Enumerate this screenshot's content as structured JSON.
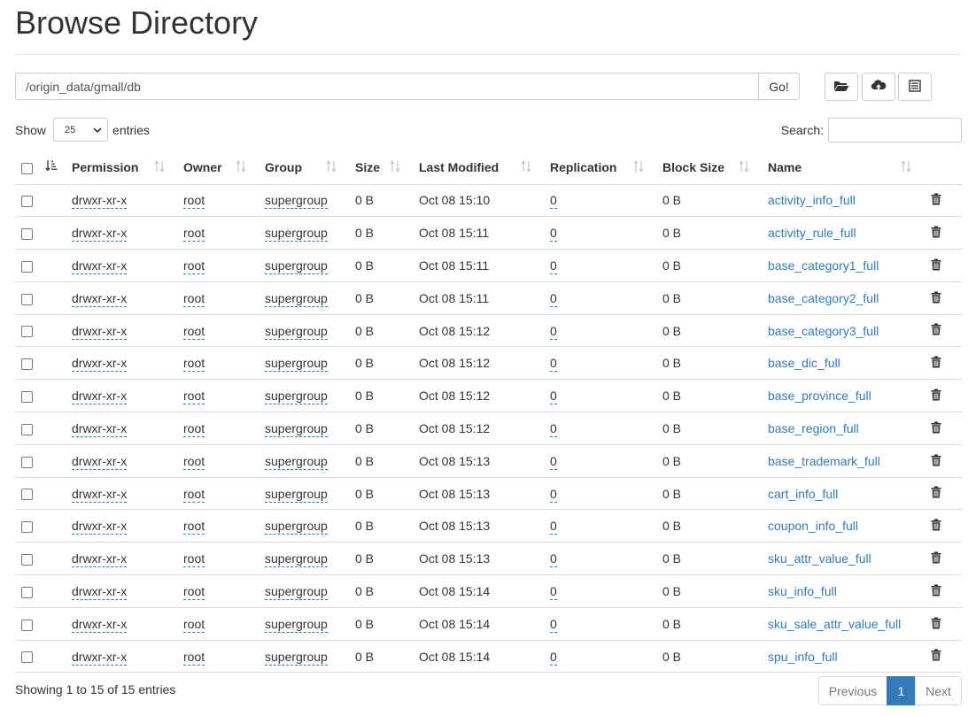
{
  "page_title": "Browse Directory",
  "path": {
    "value": "/origin_data/gmall/db",
    "go_label": "Go!"
  },
  "toolbar": {
    "icons": [
      "folder-open-icon",
      "cloud-upload-icon",
      "list-alt-icon"
    ]
  },
  "show_entries": {
    "show_label": "Show",
    "selected": "25",
    "entries_label": "entries"
  },
  "search": {
    "label": "Search:",
    "value": ""
  },
  "table": {
    "columns": [
      "Permission",
      "Owner",
      "Group",
      "Size",
      "Last Modified",
      "Replication",
      "Block Size",
      "Name"
    ],
    "rows": [
      {
        "permission": "drwxr-xr-x",
        "owner": "root",
        "group": "supergroup",
        "size": "0 B",
        "modified": "Oct 08 15:10",
        "replication": "0",
        "block_size": "0 B",
        "name": "activity_info_full"
      },
      {
        "permission": "drwxr-xr-x",
        "owner": "root",
        "group": "supergroup",
        "size": "0 B",
        "modified": "Oct 08 15:11",
        "replication": "0",
        "block_size": "0 B",
        "name": "activity_rule_full"
      },
      {
        "permission": "drwxr-xr-x",
        "owner": "root",
        "group": "supergroup",
        "size": "0 B",
        "modified": "Oct 08 15:11",
        "replication": "0",
        "block_size": "0 B",
        "name": "base_category1_full"
      },
      {
        "permission": "drwxr-xr-x",
        "owner": "root",
        "group": "supergroup",
        "size": "0 B",
        "modified": "Oct 08 15:11",
        "replication": "0",
        "block_size": "0 B",
        "name": "base_category2_full"
      },
      {
        "permission": "drwxr-xr-x",
        "owner": "root",
        "group": "supergroup",
        "size": "0 B",
        "modified": "Oct 08 15:12",
        "replication": "0",
        "block_size": "0 B",
        "name": "base_category3_full"
      },
      {
        "permission": "drwxr-xr-x",
        "owner": "root",
        "group": "supergroup",
        "size": "0 B",
        "modified": "Oct 08 15:12",
        "replication": "0",
        "block_size": "0 B",
        "name": "base_dic_full"
      },
      {
        "permission": "drwxr-xr-x",
        "owner": "root",
        "group": "supergroup",
        "size": "0 B",
        "modified": "Oct 08 15:12",
        "replication": "0",
        "block_size": "0 B",
        "name": "base_province_full"
      },
      {
        "permission": "drwxr-xr-x",
        "owner": "root",
        "group": "supergroup",
        "size": "0 B",
        "modified": "Oct 08 15:12",
        "replication": "0",
        "block_size": "0 B",
        "name": "base_region_full"
      },
      {
        "permission": "drwxr-xr-x",
        "owner": "root",
        "group": "supergroup",
        "size": "0 B",
        "modified": "Oct 08 15:13",
        "replication": "0",
        "block_size": "0 B",
        "name": "base_trademark_full"
      },
      {
        "permission": "drwxr-xr-x",
        "owner": "root",
        "group": "supergroup",
        "size": "0 B",
        "modified": "Oct 08 15:13",
        "replication": "0",
        "block_size": "0 B",
        "name": "cart_info_full"
      },
      {
        "permission": "drwxr-xr-x",
        "owner": "root",
        "group": "supergroup",
        "size": "0 B",
        "modified": "Oct 08 15:13",
        "replication": "0",
        "block_size": "0 B",
        "name": "coupon_info_full"
      },
      {
        "permission": "drwxr-xr-x",
        "owner": "root",
        "group": "supergroup",
        "size": "0 B",
        "modified": "Oct 08 15:13",
        "replication": "0",
        "block_size": "0 B",
        "name": "sku_attr_value_full"
      },
      {
        "permission": "drwxr-xr-x",
        "owner": "root",
        "group": "supergroup",
        "size": "0 B",
        "modified": "Oct 08 15:14",
        "replication": "0",
        "block_size": "0 B",
        "name": "sku_info_full"
      },
      {
        "permission": "drwxr-xr-x",
        "owner": "root",
        "group": "supergroup",
        "size": "0 B",
        "modified": "Oct 08 15:14",
        "replication": "0",
        "block_size": "0 B",
        "name": "sku_sale_attr_value_full"
      },
      {
        "permission": "drwxr-xr-x",
        "owner": "root",
        "group": "supergroup",
        "size": "0 B",
        "modified": "Oct 08 15:14",
        "replication": "0",
        "block_size": "0 B",
        "name": "spu_info_full"
      }
    ]
  },
  "footer": {
    "info": "Showing 1 to 15 of 15 entries",
    "pagination": {
      "previous": "Previous",
      "current": "1",
      "next": "Next"
    }
  },
  "colors": {
    "link": "#337ab7",
    "border": "#dddddd",
    "active_page_bg": "#337ab7",
    "icon": "#555555"
  }
}
